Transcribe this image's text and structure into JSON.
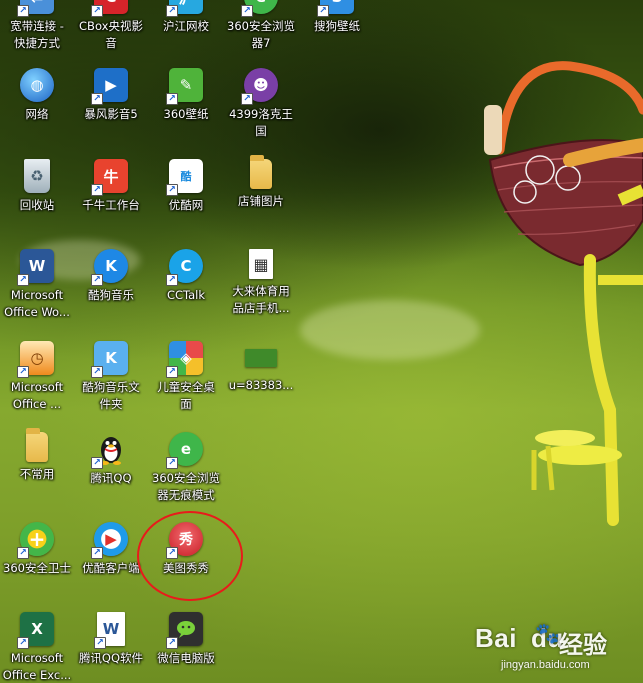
{
  "desktop": {
    "icons": [
      {
        "id": "broadband",
        "label": "宽带连接 -\n快捷方式",
        "icon": "network-connection-icon",
        "color": "#4a90d9",
        "glyph": "⇄"
      },
      {
        "id": "cbox",
        "label": "CBox央视影\n音",
        "icon": "cbox-icon",
        "color": "#d6242a",
        "glyph": "C"
      },
      {
        "id": "hujiang",
        "label": "沪江网校",
        "icon": "hujiang-school-icon",
        "color": "#27a8e0",
        "glyph": "沪"
      },
      {
        "id": "browser360",
        "label": "360安全浏览\n器7",
        "icon": "browser-360-icon",
        "color": "#3fb64a",
        "glyph": "e"
      },
      {
        "id": "sogou-wallpaper",
        "label": "搜狗壁纸",
        "icon": "sogou-wallpaper-icon",
        "color": "#2f8fe3",
        "glyph": "S"
      },
      {
        "id": "network",
        "label": "网络",
        "icon": "network-globe-icon",
        "color": "#2c7fd6",
        "glyph": "◍"
      },
      {
        "id": "baofeng",
        "label": "暴风影音5",
        "icon": "baofeng-player-icon",
        "color": "#1e6fc8",
        "glyph": "▶"
      },
      {
        "id": "wallpaper360",
        "label": "360壁纸",
        "icon": "wallpaper-360-icon",
        "color": "#4fb33a",
        "glyph": "✎"
      },
      {
        "id": "game4399",
        "label": "4399洛克王\n国",
        "icon": "roco-kingdom-icon",
        "color": "#7a3fa6",
        "glyph": "☻"
      },
      {
        "id": "recycle",
        "label": "回收站",
        "icon": "recycle-bin-icon",
        "color": "#cfd8dc",
        "glyph": "🗑"
      },
      {
        "id": "qianniu",
        "label": "千牛工作台",
        "icon": "qianniu-workbench-icon",
        "color": "#e8432e",
        "glyph": "牛"
      },
      {
        "id": "youku-net",
        "label": "优酷网",
        "icon": "youku-web-icon",
        "color": "#ffffff",
        "glyph": "酷"
      },
      {
        "id": "shop-images",
        "label": "店铺图片",
        "icon": "folder-icon",
        "color": "#e7b94a",
        "glyph": ""
      },
      {
        "id": "word",
        "label": "Microsoft\nOffice Wo...",
        "icon": "word-icon",
        "color": "#2b5797",
        "glyph": "W"
      },
      {
        "id": "kugou",
        "label": "酷狗音乐",
        "icon": "kugou-music-icon",
        "color": "#1e88e5",
        "glyph": "K"
      },
      {
        "id": "cctalk",
        "label": "CCTalk",
        "icon": "cctalk-icon",
        "color": "#1aa3e8",
        "glyph": "C"
      },
      {
        "id": "dalai",
        "label": "大来体育用\n品店手机...",
        "icon": "qr-image-icon",
        "color": "#ffffff",
        "glyph": "▦"
      },
      {
        "id": "office2",
        "label": "Microsoft\nOffice ...",
        "icon": "office-calendar-icon",
        "color": "#f08a1d",
        "glyph": "◷"
      },
      {
        "id": "kugou-folder",
        "label": "酷狗音乐文\n件夹",
        "icon": "kugou-folder-icon",
        "color": "#5ab0ef",
        "glyph": "K"
      },
      {
        "id": "kids-desktop",
        "label": "儿童安全桌\n面",
        "icon": "kids-desktop-icon",
        "color": "#e84a4a",
        "glyph": "◈"
      },
      {
        "id": "image-file",
        "label": "u=83383...",
        "icon": "image-thumbnail-icon",
        "color": "#3f8a2a",
        "glyph": "▬"
      },
      {
        "id": "uncommon",
        "label": "不常用",
        "icon": "folder-icon",
        "color": "#e7b94a",
        "glyph": ""
      },
      {
        "id": "qq",
        "label": "腾讯QQ",
        "icon": "qq-penguin-icon",
        "color": "#222222",
        "glyph": "🐧"
      },
      {
        "id": "incognito360",
        "label": "360安全浏览\n器无痕模式",
        "icon": "browser-incognito-icon",
        "color": "#3fb64a",
        "glyph": "e"
      },
      {
        "id": "guard360",
        "label": "360安全卫士",
        "icon": "security-guard-360-icon",
        "color": "#43b649",
        "glyph": "+"
      },
      {
        "id": "youku-client",
        "label": "优酷客户端",
        "icon": "youku-client-icon",
        "color": "#1f9bea",
        "glyph": "▶"
      },
      {
        "id": "meitu",
        "label": "美图秀秀",
        "icon": "meitu-xiuxiu-icon",
        "color": "#d8262e",
        "glyph": "秀"
      },
      {
        "id": "excel",
        "label": "Microsoft\nOffice Exc...",
        "icon": "excel-icon",
        "color": "#1e7145",
        "glyph": "X"
      },
      {
        "id": "qq-software",
        "label": "腾讯QQ软件",
        "icon": "word-document-icon",
        "color": "#ffffff",
        "glyph": "W"
      },
      {
        "id": "wechat-pc",
        "label": "微信电脑版",
        "icon": "wechat-pc-icon",
        "color": "#2f2f2f",
        "glyph": "☺"
      }
    ]
  },
  "watermark": {
    "logo": "Bai",
    "logo_tail": "du",
    "chinese": "经验",
    "url": "jingyan.baidu.com"
  }
}
